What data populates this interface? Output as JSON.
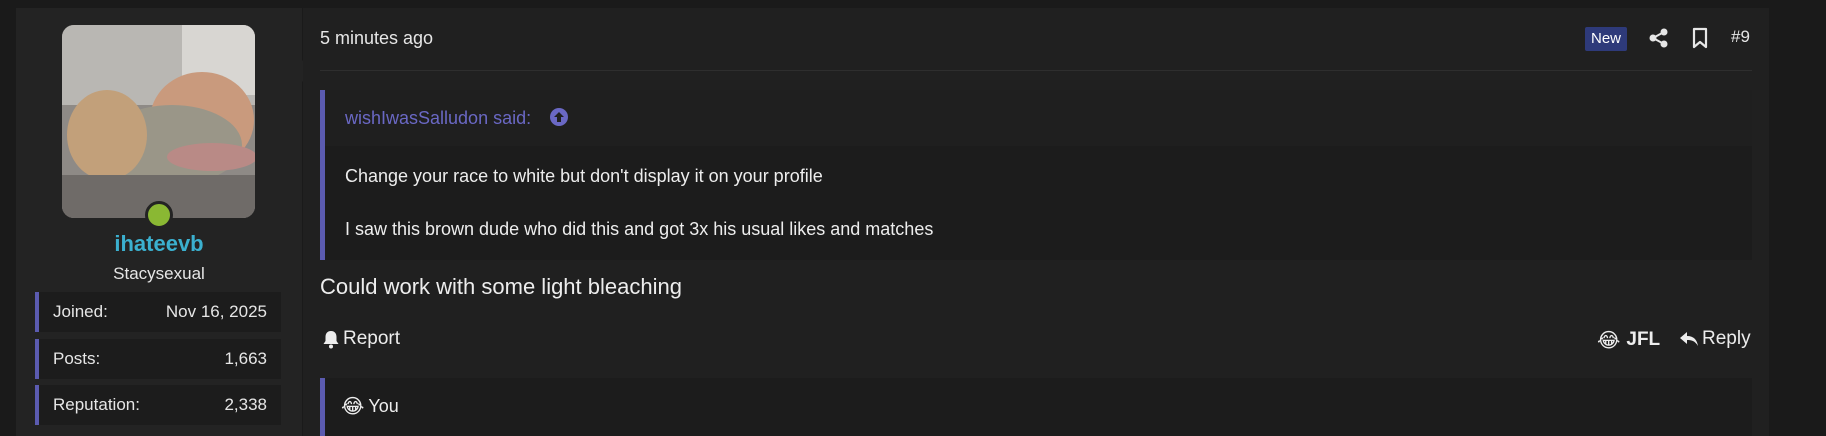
{
  "post": {
    "time": "5 minutes ago",
    "new_badge": "New",
    "number": "#9",
    "body": "Could work with some light bleaching"
  },
  "user": {
    "name": "ihateevb",
    "title": "Stacysexual",
    "status_color": "#8ab833",
    "stats": [
      {
        "label": "Joined:",
        "value": "Nov 16, 2025"
      },
      {
        "label": "Posts:",
        "value": "1,663"
      },
      {
        "label": "Reputation:",
        "value": "2,338"
      }
    ]
  },
  "quote": {
    "author": "wishIwasSalludon said:",
    "lines": [
      "Change your race to white but don't display it on your profile",
      "I saw this brown dude who did this and got 3x his usual likes and matches"
    ]
  },
  "actions": {
    "report": "Report",
    "jfl": "JFL",
    "reply": "Reply",
    "jfl_emoji": "😂"
  },
  "reactions": {
    "emoji": "😂",
    "text": "You"
  },
  "colors": {
    "accent": "#5b5bb0",
    "username": "#3bb0cf",
    "quote_author": "#6a68c4",
    "new_badge": "#2e3a7a"
  }
}
